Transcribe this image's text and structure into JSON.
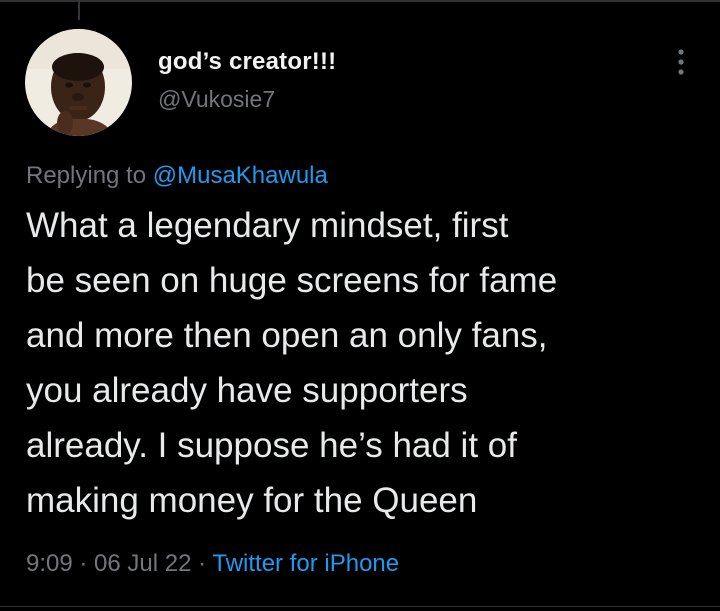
{
  "author": {
    "display_name": "god’s creator!!!",
    "handle": "@Vukosie7"
  },
  "reply": {
    "prefix": "Replying to ",
    "mention": "@MusaKhawula"
  },
  "tweet": {
    "lines": [
      "What a legendary mindset, first",
      "be seen on huge screens for fame",
      "and more then open an only fans,",
      "you already have supporters",
      "already. I suppose he’s had it of",
      "making money for the Queen"
    ]
  },
  "meta": {
    "time": "9:09",
    "separator": " · ",
    "date": "06 Jul 22",
    "source": "Twitter for iPhone"
  },
  "icons": {
    "more": "more-vertical-icon"
  },
  "colors": {
    "background": "#000000",
    "text_primary": "#e7e9ea",
    "text_secondary": "#71767b",
    "link": "#1d9bf0"
  }
}
